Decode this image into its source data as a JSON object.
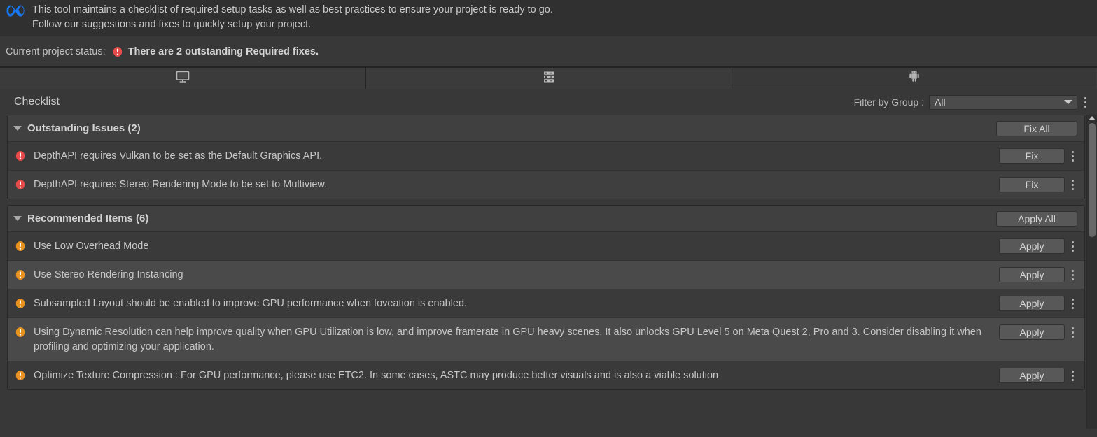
{
  "header": {
    "logo_icon": "meta-logo-icon",
    "description_line1": "This tool maintains a checklist of required setup tasks as well as best practices to ensure your project is ready to go.",
    "description_line2": "Follow our suggestions and fixes to quickly setup your project."
  },
  "status": {
    "label": "Current project status:",
    "icon": "error-icon",
    "message": "There are 2 outstanding Required fixes."
  },
  "tabs": [
    {
      "name": "tab-standalone",
      "icon": "monitor-icon",
      "selected": false
    },
    {
      "name": "tab-server",
      "icon": "server-stack-icon",
      "selected": false
    },
    {
      "name": "tab-android",
      "icon": "android-icon",
      "selected": true
    }
  ],
  "toolbar": {
    "title": "Checklist",
    "filter_label": "Filter by Group :",
    "filter_value": "All",
    "filter_options": [
      "All"
    ],
    "menu_icon": "kebab-menu-icon"
  },
  "colors": {
    "error": "#e54b4b",
    "warning": "#e8921f",
    "accent": "#1877f2",
    "background": "#383838"
  },
  "groups": [
    {
      "title": "Outstanding Issues (2)",
      "action_label": "Fix All",
      "action_name": "fix-all-button",
      "items": [
        {
          "severity": "error-icon",
          "text": "DepthAPI requires Vulkan to be set as the Default Graphics API.",
          "action_label": "Fix"
        },
        {
          "severity": "error-icon",
          "text": "DepthAPI requires Stereo Rendering Mode to be set to Multiview.",
          "action_label": "Fix"
        }
      ]
    },
    {
      "title": "Recommended Items (6)",
      "action_label": "Apply All",
      "action_name": "apply-all-button",
      "items": [
        {
          "severity": "warning-icon",
          "text": "Use Low Overhead Mode",
          "action_label": "Apply"
        },
        {
          "severity": "warning-icon",
          "text": "Use Stereo Rendering Instancing",
          "action_label": "Apply"
        },
        {
          "severity": "warning-icon",
          "text": "Subsampled Layout should be enabled to improve GPU performance when foveation is enabled.",
          "action_label": "Apply"
        },
        {
          "severity": "warning-icon",
          "text": "Using Dynamic Resolution can help improve quality when GPU Utilization is low, and improve framerate in GPU heavy scenes. It also unlocks GPU Level 5 on Meta Quest 2, Pro and 3. Consider disabling it when profiling and optimizing your application.",
          "action_label": "Apply"
        },
        {
          "severity": "warning-icon",
          "text": "Optimize Texture Compression : For GPU performance, please use ETC2. In some cases, ASTC may produce better visuals and is also a viable solution",
          "action_label": "Apply"
        }
      ]
    }
  ],
  "scrollbar": {
    "up_arrow_icon": "scroll-up-arrow-icon",
    "thumb_name": "scrollbar-thumb"
  }
}
